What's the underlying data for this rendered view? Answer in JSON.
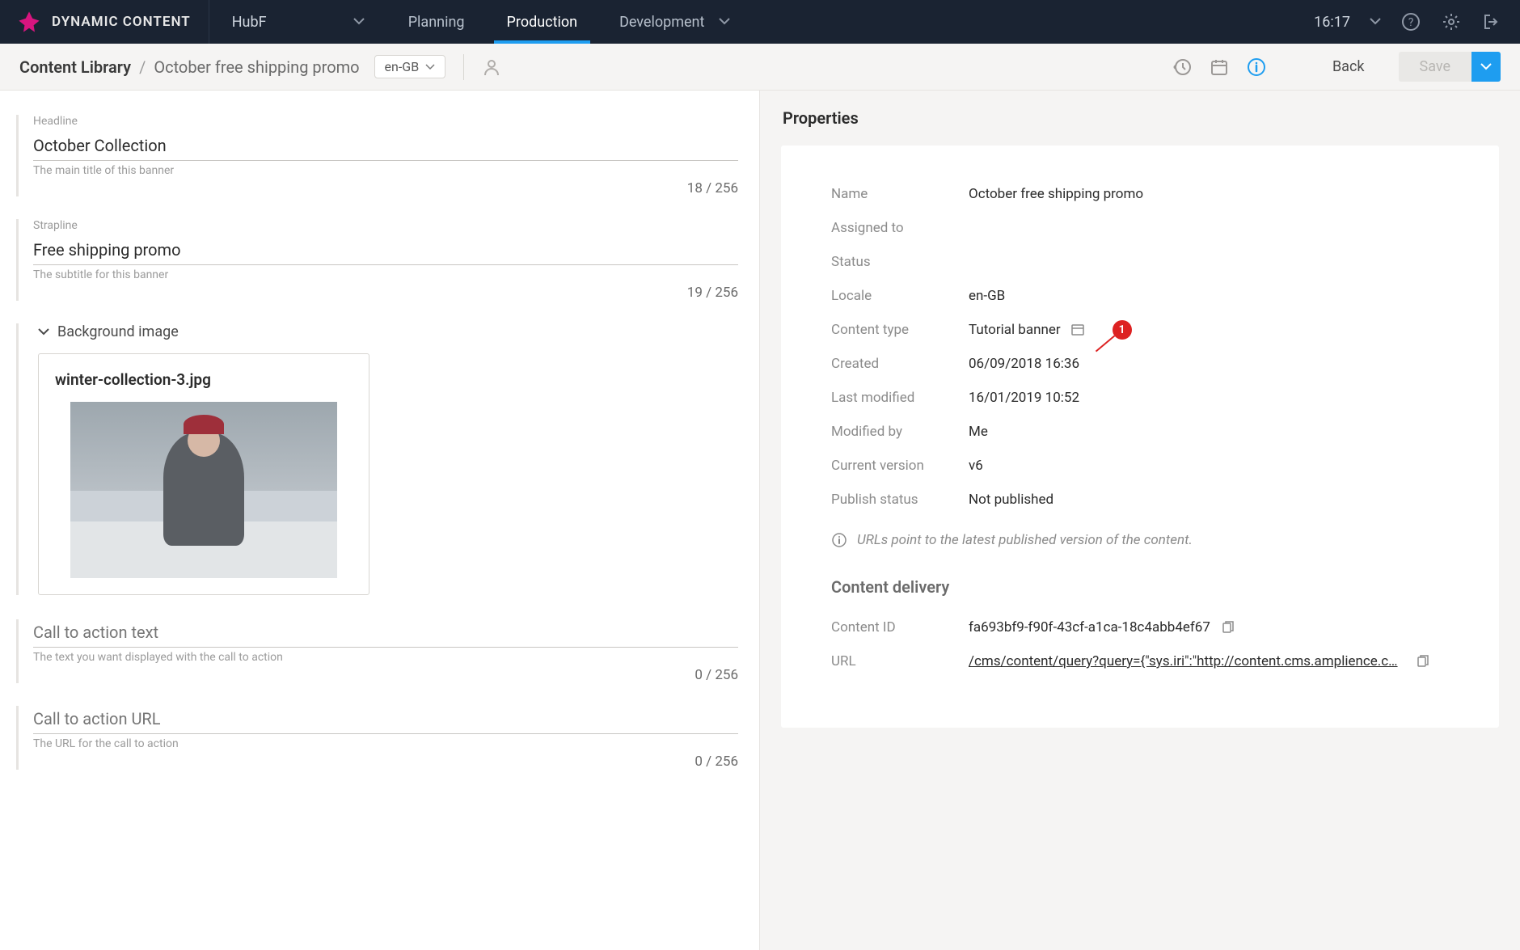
{
  "brand": "DYNAMIC CONTENT",
  "hub": "HubF",
  "nav_tabs": [
    "Planning",
    "Production",
    "Development"
  ],
  "clock": "16:17",
  "breadcrumb": {
    "root": "Content Library",
    "leaf": "October free shipping promo"
  },
  "locale_pill": "en-GB",
  "back_label": "Back",
  "save_label": "Save",
  "fields": {
    "headline": {
      "label": "Headline",
      "value": "October Collection",
      "hint": "The main title of this banner",
      "counter": "18 / 256"
    },
    "strapline": {
      "label": "Strapline",
      "value": "Free shipping promo",
      "hint": "The subtitle for this banner",
      "counter": "19 / 256"
    },
    "cta_text": {
      "label": "Call to action text",
      "hint": "The text you want displayed with the call to action",
      "counter": "0 / 256"
    },
    "cta_url": {
      "label": "Call to action URL",
      "hint": "The URL for the call to action",
      "counter": "0 / 256"
    }
  },
  "bg_image": {
    "section": "Background image",
    "filename": "winter-collection-3.jpg"
  },
  "properties": {
    "title": "Properties",
    "rows": {
      "name": {
        "k": "Name",
        "v": "October free shipping promo"
      },
      "assigned": {
        "k": "Assigned to",
        "v": ""
      },
      "status": {
        "k": "Status",
        "v": ""
      },
      "locale": {
        "k": "Locale",
        "v": "en-GB"
      },
      "content_type": {
        "k": "Content type",
        "v": "Tutorial banner"
      },
      "created": {
        "k": "Created",
        "v": "06/09/2018 16:36"
      },
      "modified": {
        "k": "Last modified",
        "v": "16/01/2019 10:52"
      },
      "modified_by": {
        "k": "Modified by",
        "v": "Me"
      },
      "version": {
        "k": "Current version",
        "v": "v6"
      },
      "publish": {
        "k": "Publish status",
        "v": "Not published"
      }
    },
    "note": "URLs point to the latest published version of the content.",
    "delivery_title": "Content delivery",
    "content_id": {
      "k": "Content ID",
      "v": "fa693bf9-f90f-43cf-a1ca-18c4abb4ef67"
    },
    "url": {
      "k": "URL",
      "v": "/cms/content/query?query={\"sys.iri\":\"http://content.cms.amplience.c…"
    }
  },
  "callout": "1"
}
